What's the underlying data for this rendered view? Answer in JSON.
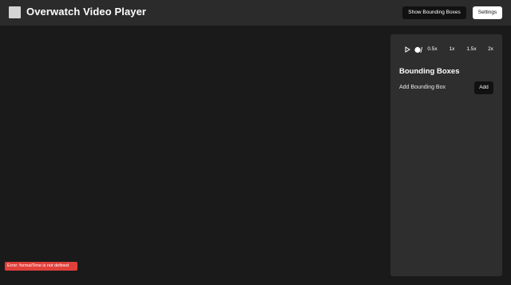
{
  "header": {
    "title": "Overwatch Video Player",
    "show_bounding_boxes_label": "Show Bounding Boxes",
    "settings_label": "Settings",
    "logo_icon": "logo-square-icon"
  },
  "video": {
    "error_message": "Error: formatTime is not defined"
  },
  "controls": {
    "play_icon": "play-icon",
    "record_icon": "record-icon",
    "speeds": [
      "0.5x",
      "1x",
      "1.5x",
      "2x"
    ]
  },
  "bounding_boxes": {
    "title": "Bounding Boxes",
    "add_label": "Add Bounding Box",
    "add_button_label": "Add"
  },
  "colors": {
    "background": "#1a1a1a",
    "header": "#2b2b2b",
    "panel": "#2e2e2e",
    "error": "#e0403a",
    "button_dark": "#111111",
    "button_light": "#ffffff"
  }
}
